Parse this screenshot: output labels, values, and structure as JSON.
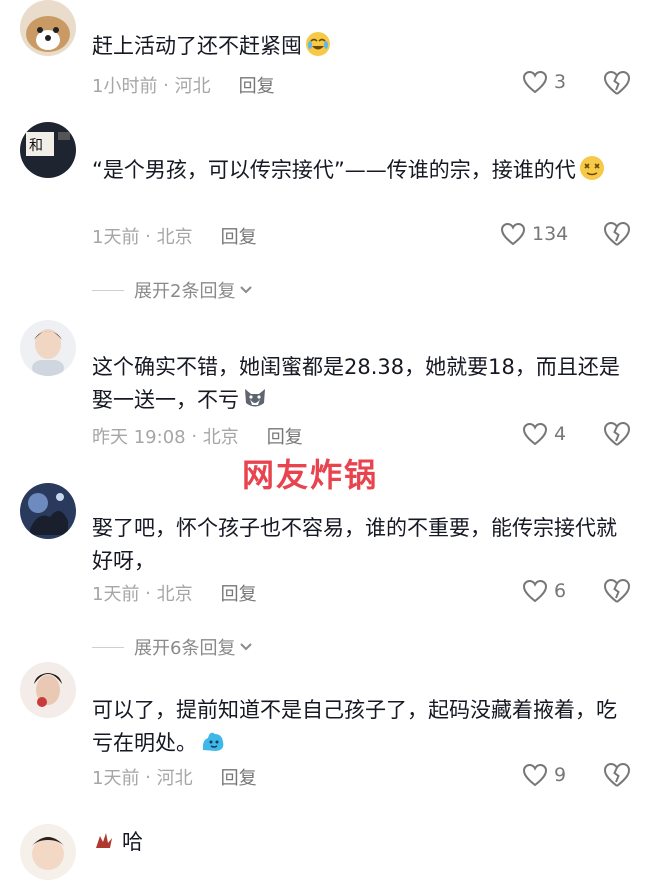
{
  "comments": [
    {
      "username": "",
      "text": "赶上活动了还不赶紧囤",
      "time": "1小时前",
      "location": "河北",
      "reply_label": "回复",
      "likes": "3",
      "emoji": "crying-laugh-emoji"
    },
    {
      "username": "",
      "text": "“是个男孩，可以传宗接代”——传谁的宗，接谁的代",
      "time": "1天前",
      "location": "北京",
      "reply_label": "回复",
      "likes": "134",
      "emoji": "dizzy-face-emoji"
    },
    {
      "username": "",
      "text": "这个确实不错，她闺蜜都是28.38，她就要18，而且还是娶一送一，不亏",
      "time": "昨天 19:08",
      "location": "北京",
      "reply_label": "回复",
      "likes": "4",
      "emoji": "husky-emoji"
    },
    {
      "username": "",
      "text": "娶了吧，怀个孩子也不容易，谁的不重要，能传宗接代就好呀，",
      "time": "1天前",
      "location": "北京",
      "reply_label": "回复",
      "likes": "6",
      "emoji": ""
    },
    {
      "username": "",
      "text": "可以了，提前知道不是自己孩子了，起码没藏着掖着，吃亏在明处。",
      "time": "1天前",
      "location": "河北",
      "reply_label": "回复",
      "likes": "9",
      "emoji": "blue-blob-emoji"
    }
  ],
  "expand_replies": [
    {
      "label": "展开2条回复"
    },
    {
      "label": "展开6条回复"
    }
  ],
  "partial_comment": {
    "username": "哈"
  },
  "overlay_text": "网友炸锅",
  "colors": {
    "overlay": "#e8444f",
    "meta": "#a6a6a6",
    "text": "#161823"
  }
}
